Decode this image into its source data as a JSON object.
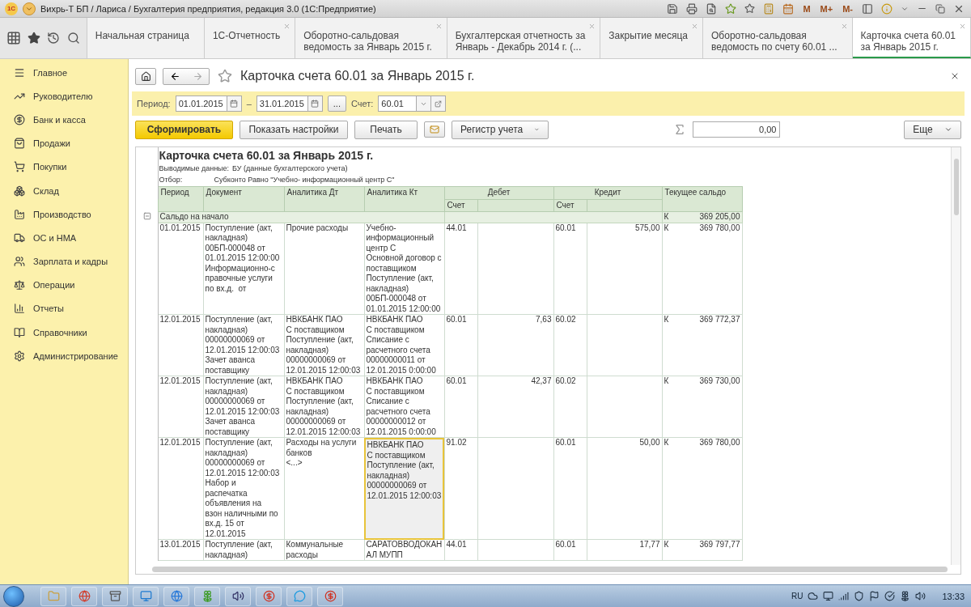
{
  "window": {
    "logo": "1С",
    "title": "Вихрь-Т БП / Лариса / Бухгалтерия предприятия, редакция 3.0  (1С:Предприятие)",
    "memory_buttons": [
      "M",
      "M+",
      "M-"
    ]
  },
  "tabs": [
    {
      "label": "Начальная страница",
      "selected": false,
      "closable": false
    },
    {
      "label": "1С-Отчетность",
      "selected": false,
      "closable": true
    },
    {
      "label": "Оборотно-сальдовая\nведомость за Январь 2015 г.",
      "selected": false,
      "closable": true
    },
    {
      "label": "Бухгалтерская отчетность за\nЯнварь - Декабрь 2014 г. (...",
      "selected": false,
      "closable": true
    },
    {
      "label": "Закрытие месяца",
      "selected": false,
      "closable": true
    },
    {
      "label": "Оборотно-сальдовая\nведомость по счету 60.01 ...",
      "selected": false,
      "closable": true
    },
    {
      "label": "Карточка счета 60.01\nза Январь 2015 г.",
      "selected": true,
      "closable": true
    }
  ],
  "sidebar": {
    "items": [
      "Главное",
      "Руководителю",
      "Банк и касса",
      "Продажи",
      "Покупки",
      "Склад",
      "Производство",
      "ОС и НМА",
      "Зарплата и кадры",
      "Операции",
      "Отчеты",
      "Справочники",
      "Администрирование"
    ]
  },
  "form": {
    "title": "Карточка счета 60.01 за Январь 2015 г.",
    "filter": {
      "period_label": "Период:",
      "date_from": "01.01.2015",
      "dash": "–",
      "date_to": "31.01.2015",
      "more": "...",
      "account_label": "Счет:",
      "account": "60.01"
    },
    "buttons": {
      "generate": "Сформировать",
      "settings": "Показать настройки",
      "print": "Печать",
      "register": "Регистр учета",
      "sum": "0,00",
      "more": "Еще"
    }
  },
  "report": {
    "title": "Карточка счета 60.01 за Январь 2015 г.",
    "info": [
      {
        "label": "Выводимые данные:",
        "value": "БУ (данные бухгалтерского учета)"
      },
      {
        "label": "Отбор:",
        "value": "Субконто Равно \"Учебно- информационный центр С\""
      }
    ],
    "columns": {
      "period": "Период",
      "document": "Документ",
      "analytics_dt": "Аналитика Дт",
      "analytics_kt": "Аналитика Кт",
      "debit": "Дебет",
      "credit": "Кредит",
      "debit_account": "Счет",
      "credit_account": "Счет",
      "balance": "Текущее сальдо"
    },
    "opening": {
      "label": "Сальдо на начало",
      "side": "К",
      "balance": "369 205,00",
      "expanded": true
    },
    "rows": [
      {
        "period": "01.01.2015",
        "document": "Поступление (акт,\nнакладная)\n00БП-000048 от\n01.01.2015 12:00:00\nИнформационно-с\nправочные услуги\nпо вх.д.  от",
        "analytics_dt": "Прочие расходы",
        "analytics_kt": "Учебно-\nинформационный\nцентр С\nОсновной договор с\nпоставщиком\nПоступление (акт,\nнакладная)\n00БП-000048 от\n01.01.2015 12:00:00",
        "debit_account": "44.01",
        "credit_account": "60.01",
        "credit_amount": "575,00",
        "side": "К",
        "balance": "369 780,00",
        "kt_selected": false
      },
      {
        "period": "12.01.2015",
        "document": "Поступление (акт,\nнакладная)\n00000000069 от\n12.01.2015 12:00:03\nЗачет аванса\nпоставщику",
        "analytics_dt": "НВКБАНК ПАО\nС поставщиком\nПоступление (акт,\nнакладная)\n00000000069 от\n12.01.2015 12:00:03",
        "analytics_kt": "НВКБАНК ПАО\nС поставщиком\nСписание с\nрасчетного счета\n00000000011 от\n12.01.2015 0:00:00",
        "debit_account": "60.01",
        "debit_amount": "7,63",
        "credit_account": "60.02",
        "side": "К",
        "balance": "369 772,37",
        "kt_selected": false
      },
      {
        "period": "12.01.2015",
        "document": "Поступление (акт,\nнакладная)\n00000000069 от\n12.01.2015 12:00:03\nЗачет аванса\nпоставщику",
        "analytics_dt": "НВКБАНК ПАО\nС поставщиком\nПоступление (акт,\nнакладная)\n00000000069 от\n12.01.2015 12:00:03",
        "analytics_kt": "НВКБАНК ПАО\nС поставщиком\nСписание с\nрасчетного счета\n00000000012 от\n12.01.2015 0:00:00",
        "debit_account": "60.01",
        "debit_amount": "42,37",
        "credit_account": "60.02",
        "side": "К",
        "balance": "369 730,00",
        "kt_selected": false
      },
      {
        "period": "12.01.2015",
        "document": "Поступление (акт,\nнакладная)\n00000000069 от\n12.01.2015 12:00:03\nНабор и\nраспечатка\nобъявления на\nвзон наличными по\nвх.д. 15 от\n12.01.2015",
        "analytics_dt": "Расходы на услуги\nбанков\n<...>",
        "analytics_kt": "НВКБАНК ПАО\nС поставщиком\nПоступление (акт,\nнакладная)\n00000000069 от\n12.01.2015 12:00:03",
        "debit_account": "91.02",
        "credit_account": "60.01",
        "credit_amount": "50,00",
        "side": "К",
        "balance": "369 780,00",
        "kt_selected": true
      },
      {
        "period": "13.01.2015",
        "document": "Поступление (акт,\nнакладная)",
        "analytics_dt": "Коммунальные\nрасходы",
        "analytics_kt": "САРАТОВВОДОКАН\nАЛ МУПП",
        "debit_account": "44.01",
        "credit_account": "60.01",
        "credit_amount": "17,77",
        "side": "К",
        "balance": "369 797,77",
        "kt_selected": false
      }
    ]
  },
  "taskbar": {
    "language": "RU",
    "time": "13:33"
  }
}
